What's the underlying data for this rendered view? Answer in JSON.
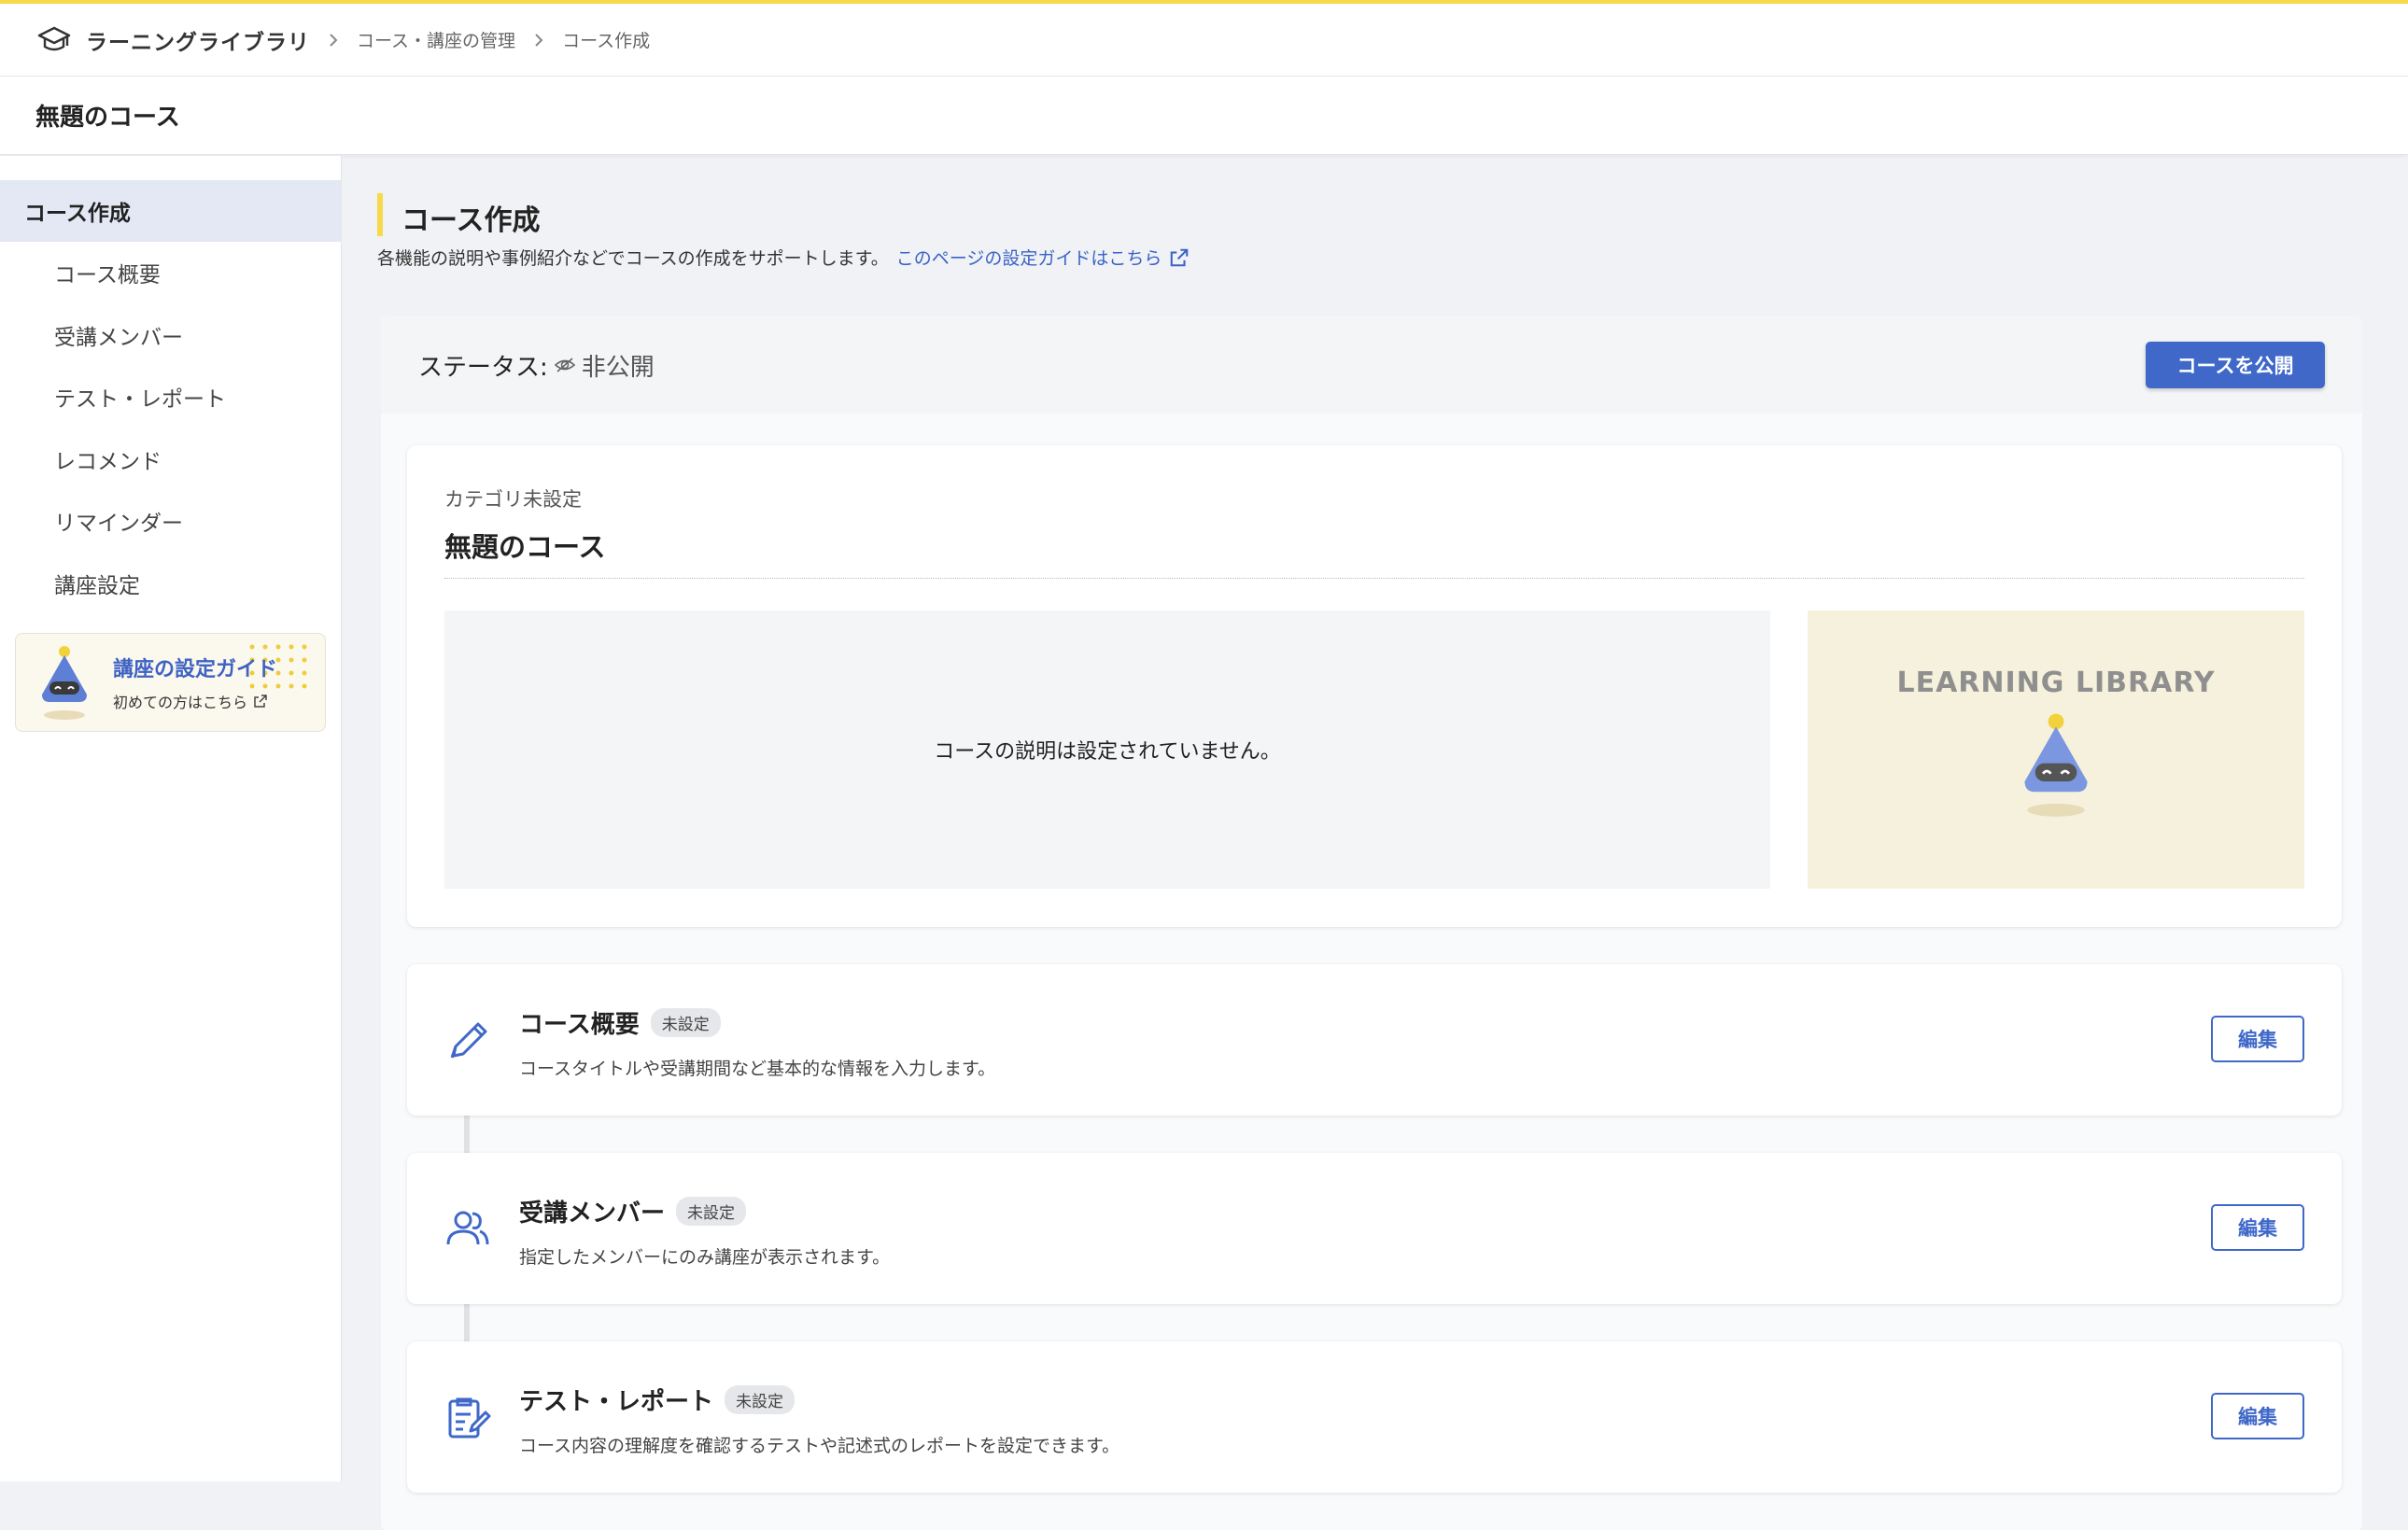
{
  "header": {
    "brand": "ラーニングライブラリ",
    "breadcrumb": [
      "コース・講座の管理",
      "コース作成"
    ]
  },
  "title_bar": {
    "title": "無題のコース"
  },
  "sidebar": {
    "active": "コース作成",
    "items": [
      {
        "label": "コース概要"
      },
      {
        "label": "受講メンバー"
      },
      {
        "label": "テスト・レポート"
      },
      {
        "label": "レコメンド"
      },
      {
        "label": "リマインダー"
      },
      {
        "label": "講座設定"
      }
    ],
    "guide": {
      "title": "講座の設定ガイド",
      "subtitle": "初めての方はこちら"
    }
  },
  "main": {
    "heading": "コース作成",
    "intro": "各機能の説明や事例紹介などでコースの作成をサポートします。",
    "intro_link": "このページの設定ガイドはこちら",
    "status_label": "ステータス:",
    "status_value": "非公開",
    "publish_button": "コースを公開",
    "course_card": {
      "category": "カテゴリ未設定",
      "title": "無題のコース",
      "description": "コースの説明は設定されていません。",
      "thumbnail_text": "LEARNING LIBRARY"
    },
    "steps": [
      {
        "title": "コース概要",
        "badge": "未設定",
        "desc": "コースタイトルや受講期間など基本的な情報を入力します。",
        "button": "編集",
        "icon": "pencil-icon"
      },
      {
        "title": "受講メンバー",
        "badge": "未設定",
        "desc": "指定したメンバーにのみ講座が表示されます。",
        "button": "編集",
        "icon": "users-icon"
      },
      {
        "title": "テスト・レポート",
        "badge": "未設定",
        "desc": "コース内容の理解度を確認するテストや記述式のレポートを設定できます。",
        "button": "編集",
        "icon": "clipboard-edit-icon"
      }
    ]
  },
  "colors": {
    "accent": "#3f68c9",
    "highlight": "#f7d94c"
  }
}
